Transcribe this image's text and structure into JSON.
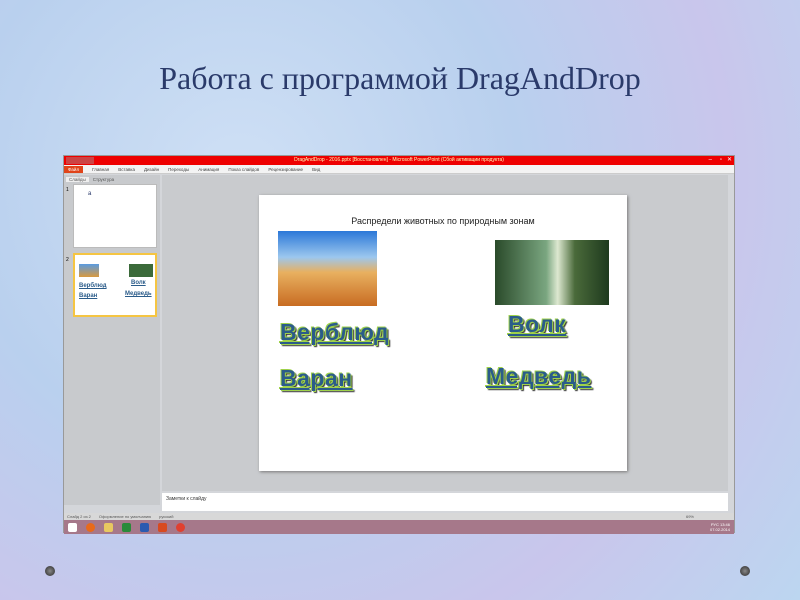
{
  "slide_title": "Работа  с программой DragAndDrop",
  "window": {
    "title": "DragAndDrop - 2016.pptx [Восстановлен] - Microsoft PowerPoint (Сбой активации продукта)",
    "ribbon_tabs": [
      "Файл",
      "Главная",
      "Вставка",
      "Дизайн",
      "Переходы",
      "Анимация",
      "Показ слайдов",
      "Рецензирование",
      "Вид"
    ],
    "panel_tabs": [
      "Слайды",
      "Структура"
    ],
    "thumb1_number": "1",
    "thumb2_number": "2",
    "thumb1_text": "а",
    "notes_placeholder": "Заметки к слайду",
    "status": [
      "Слайд 2 из 2",
      "Оформление по умолчанию",
      "русский"
    ],
    "zoom": "69%",
    "lang": "РУС",
    "time": "13:46",
    "date": "07.02.2014"
  },
  "slide": {
    "heading": "Распредели животных по природным зонам",
    "words": [
      "Верблюд",
      "Волк",
      "Варан",
      "Медведь"
    ]
  }
}
